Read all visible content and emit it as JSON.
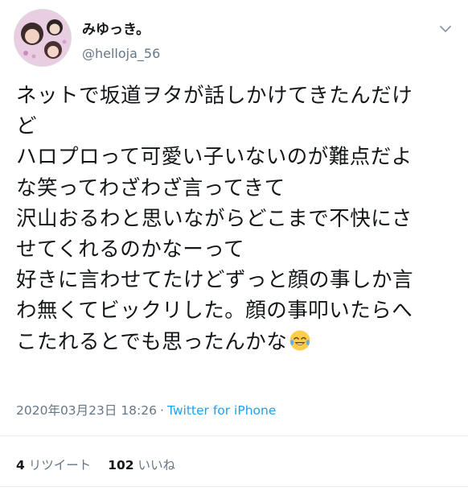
{
  "user": {
    "display_name": "みゆっき。",
    "handle": "@helloja_56"
  },
  "tweet": {
    "lines": [
      "ネットで坂道ヲタが話しかけてきたんだけ",
      "ど",
      "ハロプロって可愛い子いないのが難点だよ",
      "な笑ってわざわざ言ってきて",
      "沢山おるわと思いながらどこまで不快にさ",
      "せてくれるのかなーって",
      "好きに言わせてたけどずっと顔の事しか言",
      "わ無くてビックリした。顔の事叩いたらへ",
      "こたれるとでも思ったんかな"
    ],
    "emoji": "joy-emoji"
  },
  "meta": {
    "timestamp": "2020年03月23日 18:26",
    "separator": "·",
    "source": "Twitter for iPhone"
  },
  "stats": {
    "retweets_count": "4",
    "retweets_label": "リツイート",
    "likes_count": "102",
    "likes_label": "いいね"
  },
  "colors": {
    "text": "#14171a",
    "secondary": "#657786",
    "link": "#1da1f2"
  }
}
